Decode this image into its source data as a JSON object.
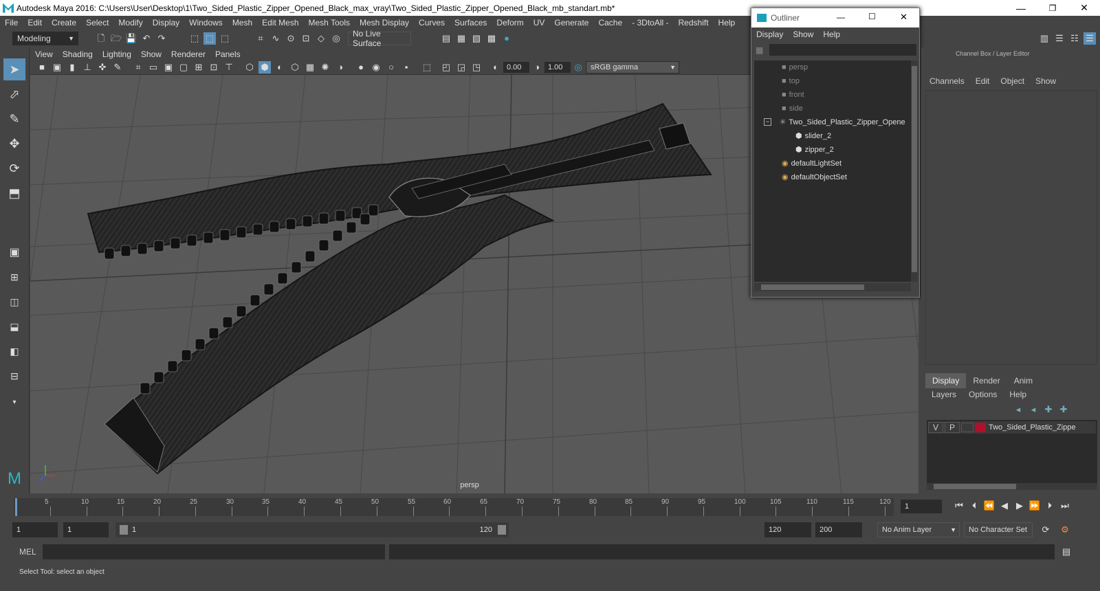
{
  "window": {
    "title": "Autodesk Maya 2016: C:\\Users\\User\\Desktop\\1\\Two_Sided_Plastic_Zipper_Opened_Black_max_vray\\Two_Sided_Plastic_Zipper_Opened_Black_mb_standart.mb*",
    "minimize": "—",
    "restore": "❐",
    "close": "✕"
  },
  "menubar": [
    "File",
    "Edit",
    "Create",
    "Select",
    "Modify",
    "Display",
    "Windows",
    "Mesh",
    "Edit Mesh",
    "Mesh Tools",
    "Mesh Display",
    "Curves",
    "Surfaces",
    "Deform",
    "UV",
    "Generate",
    "Cache",
    "- 3DtoAll -",
    "Redshift",
    "Help"
  ],
  "statusline": {
    "mode": "Modeling",
    "live_surface": "No Live Surface"
  },
  "viewport": {
    "menu": [
      "View",
      "Shading",
      "Lighting",
      "Show",
      "Renderer",
      "Panels"
    ],
    "exposure": "0.00",
    "gamma": "1.00",
    "color_space": "sRGB gamma",
    "camera_label": "persp"
  },
  "outliner": {
    "title": "Outliner",
    "menu": [
      "Display",
      "Show",
      "Help"
    ],
    "items": [
      {
        "label": "persp",
        "kind": "camera",
        "dim": true
      },
      {
        "label": "top",
        "kind": "camera",
        "dim": true
      },
      {
        "label": "front",
        "kind": "camera",
        "dim": true
      },
      {
        "label": "side",
        "kind": "camera",
        "dim": true
      },
      {
        "label": "Two_Sided_Plastic_Zipper_Opene",
        "kind": "group",
        "dim": false
      },
      {
        "label": "slider_2",
        "kind": "mesh",
        "dim": false
      },
      {
        "label": "zipper_2",
        "kind": "mesh",
        "dim": false
      },
      {
        "label": "defaultLightSet",
        "kind": "set",
        "dim": false
      },
      {
        "label": "defaultObjectSet",
        "kind": "set",
        "dim": false
      }
    ]
  },
  "channel_box": {
    "title": "Channel Box / Layer Editor",
    "menu": [
      "Channels",
      "Edit",
      "Object",
      "Show"
    ]
  },
  "layer_editor": {
    "tabs": [
      "Display",
      "Render",
      "Anim"
    ],
    "menu": [
      "Layers",
      "Options",
      "Help"
    ],
    "layer": {
      "v": "V",
      "p": "P",
      "name": "Two_Sided_Plastic_Zippe",
      "color": "#b0112a"
    }
  },
  "timeline": {
    "ticks": [
      "5",
      "10",
      "15",
      "20",
      "25",
      "30",
      "35",
      "40",
      "45",
      "50",
      "55",
      "60",
      "65",
      "70",
      "75",
      "80",
      "85",
      "90",
      "95",
      "100",
      "105",
      "110",
      "115",
      "120"
    ],
    "start_label": "1",
    "current_frame": "1"
  },
  "range": {
    "start": "1",
    "playback_start": "1",
    "slider_start": "1",
    "slider_end": "120",
    "playback_end": "120",
    "end": "200",
    "anim_layer": "No Anim Layer",
    "character_set": "No Character Set"
  },
  "command": {
    "lang": "MEL"
  },
  "helpline": "Select Tool: select an object"
}
